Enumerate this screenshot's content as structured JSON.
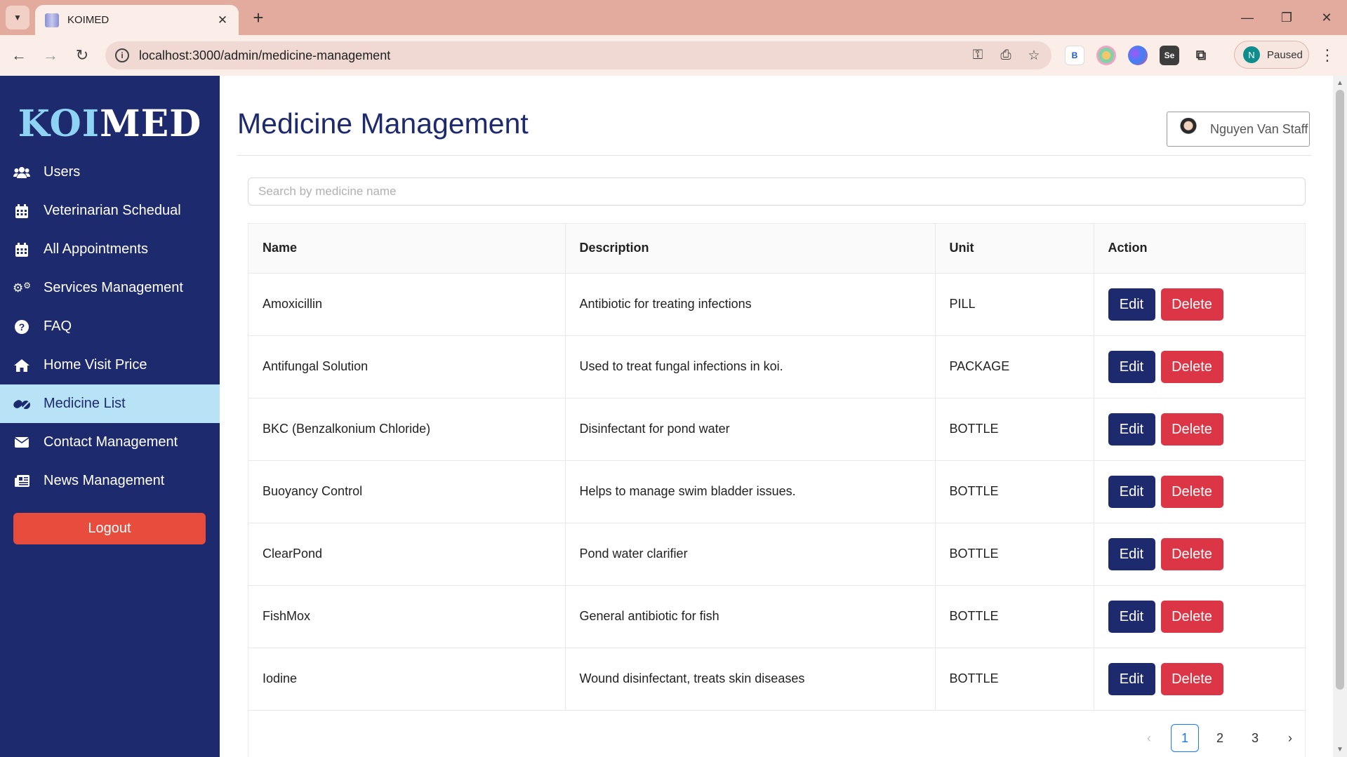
{
  "browser": {
    "tab_title": "KOIMED",
    "url": "localhost:3000/admin/medicine-management",
    "profile_initial": "N",
    "profile_status": "Paused",
    "extensions": [
      "B",
      "",
      "",
      "Se",
      ""
    ]
  },
  "sidebar": {
    "brand_part1": "KOI",
    "brand_part2": "MED",
    "items": [
      {
        "label": "Users",
        "icon": "users-icon"
      },
      {
        "label": "Veterinarian Schedual",
        "icon": "calendar-icon"
      },
      {
        "label": "All Appointments",
        "icon": "calendar-icon"
      },
      {
        "label": "Services Management",
        "icon": "cogs-icon"
      },
      {
        "label": "FAQ",
        "icon": "question-circle-icon"
      },
      {
        "label": "Home Visit Price",
        "icon": "home-icon"
      },
      {
        "label": "Medicine List",
        "icon": "pills-icon"
      },
      {
        "label": "Contact Management",
        "icon": "envelope-icon"
      },
      {
        "label": "News Management",
        "icon": "newspaper-icon"
      }
    ],
    "logout_label": "Logout"
  },
  "header": {
    "title": "Medicine Management",
    "user_name": "Nguyen Van Staff"
  },
  "search": {
    "placeholder": "Search by medicine name",
    "value": ""
  },
  "table": {
    "columns": [
      "Name",
      "Description",
      "Unit",
      "Action"
    ],
    "rows": [
      {
        "name": "Amoxicillin",
        "description": "Antibiotic for treating infections",
        "unit": "PILL"
      },
      {
        "name": "Antifungal Solution",
        "description": "Used to treat fungal infections in koi.",
        "unit": "PACKAGE"
      },
      {
        "name": "BKC (Benzalkonium Chloride)",
        "description": "Disinfectant for pond water",
        "unit": "BOTTLE"
      },
      {
        "name": "Buoyancy Control",
        "description": "Helps to manage swim bladder issues.",
        "unit": "BOTTLE"
      },
      {
        "name": "ClearPond",
        "description": "Pond water clarifier",
        "unit": "BOTTLE"
      },
      {
        "name": "FishMox",
        "description": "General antibiotic for fish",
        "unit": "BOTTLE"
      },
      {
        "name": "Iodine",
        "description": "Wound disinfectant, treats skin diseases",
        "unit": "BOTTLE"
      }
    ],
    "edit_label": "Edit",
    "delete_label": "Delete"
  },
  "pagination": {
    "prev": "‹",
    "pages": [
      "1",
      "2",
      "3"
    ],
    "current": "1",
    "next": "›"
  },
  "colors": {
    "sidebar_bg": "#1e2a6e",
    "active_item_bg": "#b8e3f7",
    "edit_button": "#1e2a6e",
    "delete_button": "#dc3545",
    "logout_button": "#e74c3c",
    "pagination_active": "#1677ff"
  }
}
